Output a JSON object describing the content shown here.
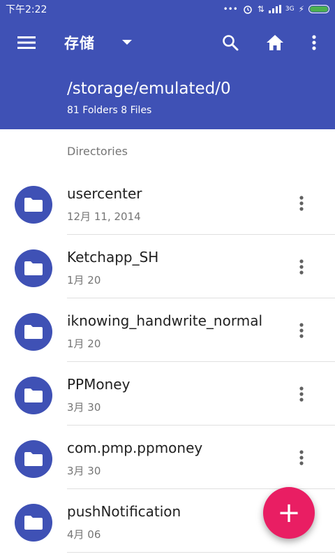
{
  "status": {
    "time": "下午2:22",
    "network": "3G"
  },
  "toolbar": {
    "title": "存储"
  },
  "header": {
    "path": "/storage/emulated/0",
    "summary": "81 Folders 8 Files"
  },
  "section_label": "Directories",
  "folders": [
    {
      "name": "usercenter",
      "date": "12月 11, 2014"
    },
    {
      "name": "Ketchapp_SH",
      "date": "1月 20"
    },
    {
      "name": "iknowing_handwrite_normal",
      "date": "1月 20"
    },
    {
      "name": "PPMoney",
      "date": "3月 30"
    },
    {
      "name": "com.pmp.ppmoney",
      "date": "3月 30"
    },
    {
      "name": "pushNotification",
      "date": "4月 06"
    }
  ],
  "fab": {
    "glyph": "+"
  },
  "colors": {
    "primary": "#3f51b5",
    "accent": "#e91e63",
    "text_primary": "#212121",
    "text_secondary": "#757575"
  }
}
